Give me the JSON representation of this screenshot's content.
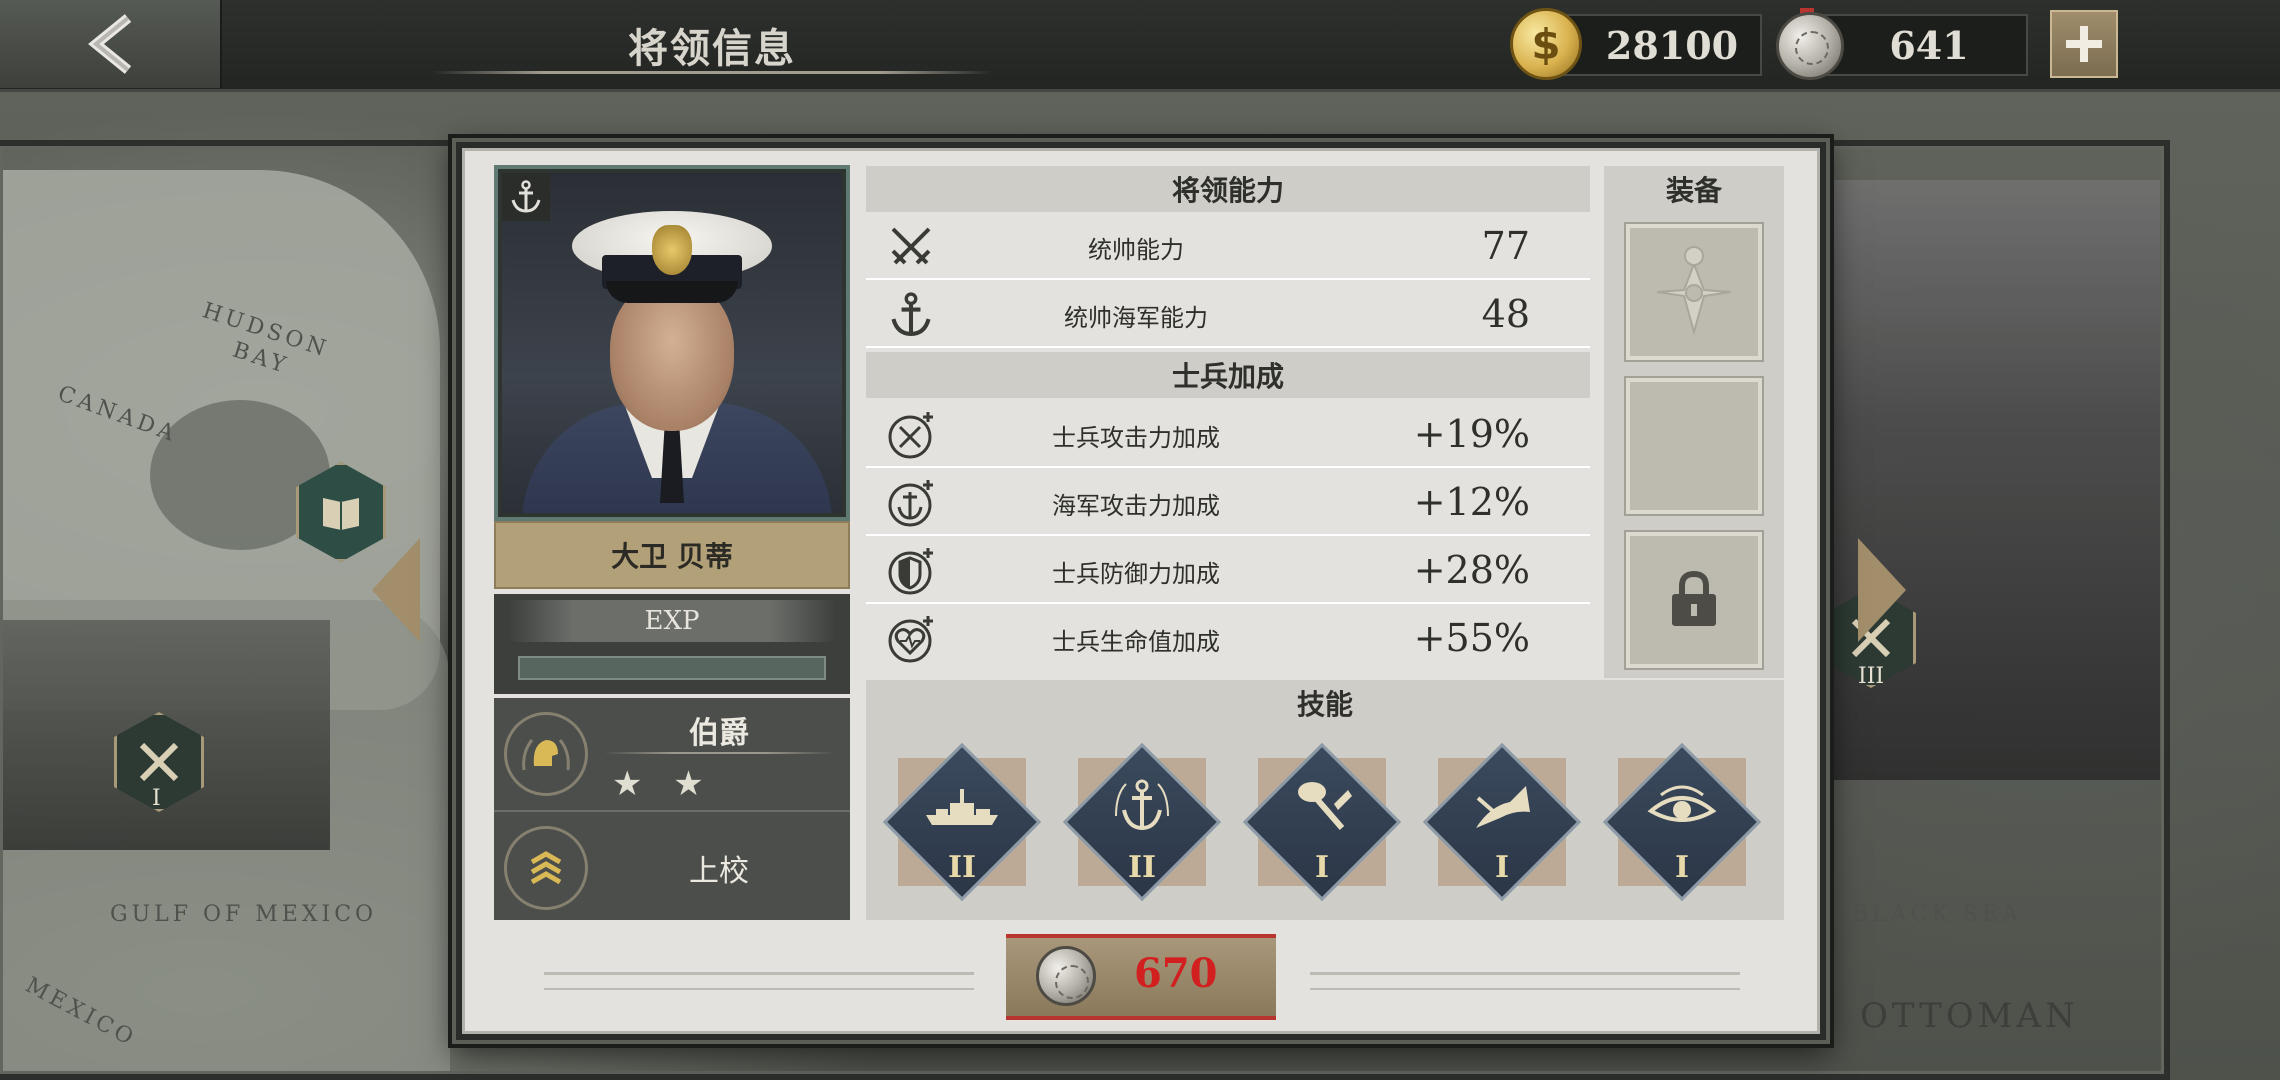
{
  "header": {
    "title": "将领信息",
    "gold": "28100",
    "medals": "641",
    "add_label": "+"
  },
  "map": {
    "labels": [
      "HUDSON",
      "BAY",
      "CANADA",
      "GULF OF MEXICO",
      "MEXICO",
      "OTTOMAN",
      "BLACK SEA"
    ],
    "marker_numerals": [
      "I",
      "III"
    ]
  },
  "general": {
    "name": "大卫 贝蒂",
    "exp_label": "EXP",
    "exp_progress": 0,
    "nobility": "伯爵",
    "stars": "★ ★",
    "star_count": 2,
    "military_rank": "上校"
  },
  "abilities": {
    "header": "将领能力",
    "items": [
      {
        "icon": "crossed-swords-icon",
        "label": "统帅能力",
        "value": "77"
      },
      {
        "icon": "anchor-icon",
        "label": "统帅海军能力",
        "value": "48"
      }
    ]
  },
  "bonuses": {
    "header": "士兵加成",
    "items": [
      {
        "icon": "attack-plus-icon",
        "label": "士兵攻击力加成",
        "value": "+19%"
      },
      {
        "icon": "naval-attack-plus-icon",
        "label": "海军攻击力加成",
        "value": "+12%"
      },
      {
        "icon": "shield-plus-icon",
        "label": "士兵防御力加成",
        "value": "+28%"
      },
      {
        "icon": "heart-plus-icon",
        "label": "士兵生命值加成",
        "value": "+55%"
      }
    ]
  },
  "equipment": {
    "header": "装备",
    "slots": [
      {
        "icon": "order-cross-icon"
      },
      {
        "icon": ""
      },
      {
        "icon": "lock-icon"
      }
    ]
  },
  "skills": {
    "header": "技能",
    "items": [
      {
        "icon": "battleship-icon",
        "level": "II"
      },
      {
        "icon": "anchor-wreath-icon",
        "level": "II"
      },
      {
        "icon": "pickaxe-icon",
        "level": "I"
      },
      {
        "icon": "horn-icon",
        "level": "I"
      },
      {
        "icon": "eye-icon",
        "level": "I"
      }
    ]
  },
  "cost": {
    "value": "670"
  },
  "colors": {
    "accent_gold": "#b2a178",
    "cost_red": "#d21f1f",
    "skill_blue": "#3b4a5e",
    "panel_bg": "#e3e2de"
  }
}
